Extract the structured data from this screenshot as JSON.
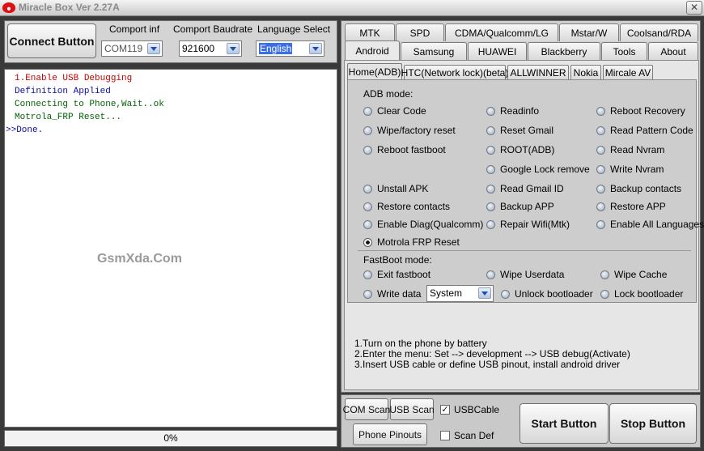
{
  "window": {
    "title": "Miracle Box Ver 2.27A"
  },
  "top": {
    "connect_label": "Connect Button",
    "comport_label": "Comport inf",
    "comport_value": "COM119",
    "baud_label": "Comport Baudrate",
    "baud_value": "921600",
    "language_label": "Language Select",
    "language_value": "English"
  },
  "log": {
    "lines": [
      "1.Enable USB Debugging",
      "Definition Applied",
      "Connecting to Phone,Wait..ok",
      "Motrola_FRP Reset...",
      ">>Done."
    ],
    "watermark": "GsmXda.Com"
  },
  "progress": {
    "value_text": "0%"
  },
  "tabs_row1": [
    "MTK",
    "SPD",
    "CDMA/Qualcomm/LG",
    "Mstar/W",
    "Coolsand/RDA"
  ],
  "tabs_row2": [
    "Android",
    "Samsung",
    "HUAWEI",
    "Blackberry",
    "Tools",
    "About"
  ],
  "subtabs": [
    "Home(ADB)",
    "HTC(Network lock)(beta)",
    "ALLWINNER",
    "Nokia",
    "Mircale AV"
  ],
  "adb": {
    "label": "ADB mode:",
    "options": [
      "Clear Code",
      "Readinfo",
      "Reboot Recovery",
      "Wipe/factory reset",
      "Reset Gmail",
      "Read Pattern Code",
      "Reboot fastboot",
      "ROOT(ADB)",
      "Read Nvram",
      "Google Lock remove",
      "Write Nvram",
      "Unstall APK",
      "Read Gmail ID",
      "Backup contacts",
      "Restore contacts",
      "Backup APP",
      "Restore APP",
      "Enable Diag(Qualcomm)",
      "Repair Wifi(Mtk)",
      "Enable All Languages",
      "Motrola FRP Reset"
    ]
  },
  "fastboot": {
    "label": "FastBoot mode:",
    "options": [
      "Exit fastboot",
      "Wipe Userdata",
      "Wipe Cache",
      "Write data",
      "Unlock bootloader",
      "Lock bootloader"
    ],
    "write_select": "System"
  },
  "instructions": [
    "1.Turn on the phone by battery",
    "2.Enter the menu: Set --> development --> USB debug(Activate)",
    "3.Insert USB cable or define USB pinout, install android driver"
  ],
  "bottom": {
    "com_scan": "COM Scan",
    "usb_scan": "USB Scan",
    "usb_cable": "USBCable",
    "phone_pinouts": "Phone Pinouts",
    "scan_def": "Scan Def",
    "start": "Start Button",
    "stop": "Stop Button"
  }
}
